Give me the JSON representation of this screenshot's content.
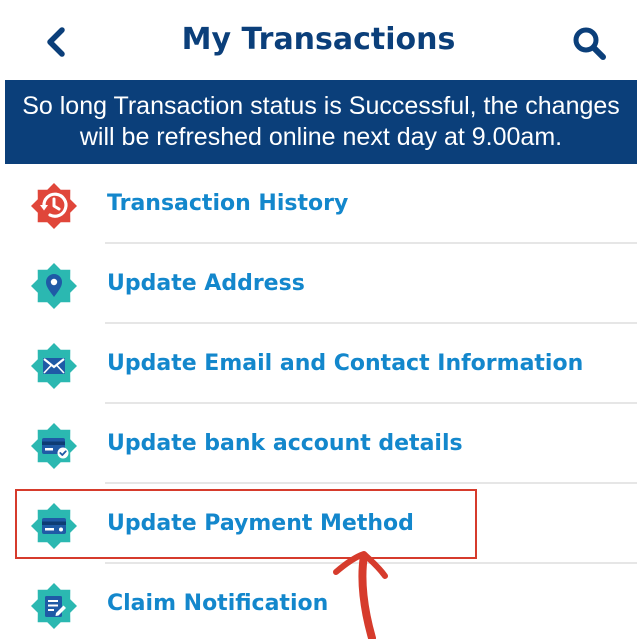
{
  "header": {
    "title": "My Transactions",
    "back_icon": "chevron-left-icon",
    "search_icon": "search-icon"
  },
  "banner": {
    "message": "So long Transaction status is Successful, the changes will be refreshed online next day at 9.00am."
  },
  "menu": {
    "items": [
      {
        "label": "Transaction History",
        "icon": "history-clock-icon",
        "icon_color": "#e0463a"
      },
      {
        "label": "Update Address",
        "icon": "location-pin-icon",
        "icon_color": "#2bb8b1"
      },
      {
        "label": "Update Email and Contact Information",
        "icon": "envelope-icon",
        "icon_color": "#2bb8b1"
      },
      {
        "label": "Update bank account details",
        "icon": "bank-card-check-icon",
        "icon_color": "#2bb8b1"
      },
      {
        "label": "Update Payment Method",
        "icon": "credit-card-icon",
        "icon_color": "#2bb8b1"
      },
      {
        "label": "Claim Notification",
        "icon": "document-edit-icon",
        "icon_color": "#2bb8b1"
      }
    ]
  },
  "colors": {
    "navy": "#0b3f7a",
    "link_blue": "#1387cc",
    "teal": "#2bb8b1",
    "red": "#e0463a",
    "annotation_red": "#d63b2c"
  }
}
